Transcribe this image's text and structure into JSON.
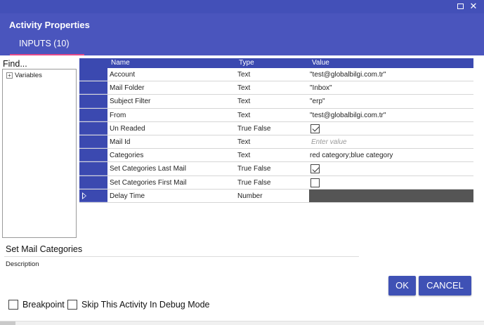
{
  "dialog": {
    "title": "Activity Properties",
    "tab_label": "INPUTS (10)"
  },
  "left_panel": {
    "find_label": "Find...",
    "tree_items": [
      {
        "toggle": "+",
        "label": "Variables"
      }
    ]
  },
  "grid": {
    "columns": {
      "name": "Name",
      "type": "Type",
      "value": "Value"
    },
    "rows": [
      {
        "name": "Account",
        "type": "Text",
        "value": "\"test@globalbilgi.com.tr\""
      },
      {
        "name": "Mail Folder",
        "type": "Text",
        "value": "\"Inbox\""
      },
      {
        "name": "Subject Filter",
        "type": "Text",
        "value": "\"erp\""
      },
      {
        "name": "From",
        "type": "Text",
        "value": "\"test@globalbilgi.com.tr\""
      },
      {
        "name": "Un Readed",
        "type": "True False",
        "checked": true
      },
      {
        "name": "Mail Id",
        "type": "Text",
        "placeholder": "Enter value"
      },
      {
        "name": "Categories",
        "type": "Text",
        "value": "red category;blue category"
      },
      {
        "name": "Set Categories Last Mail",
        "type": "True False",
        "checked": true
      },
      {
        "name": "Set Categories First Mail",
        "type": "True False",
        "checked": false
      },
      {
        "name": "Delay Time",
        "type": "Number",
        "selected": true
      }
    ]
  },
  "details": {
    "activity_name": "Set Mail Categories",
    "description_label": "Description"
  },
  "buttons": {
    "ok": "OK",
    "cancel": "CANCEL"
  },
  "options": {
    "breakpoint": "Breakpoint",
    "skip_debug": "Skip This Activity In Debug Mode"
  },
  "colors": {
    "header": "#4a55bd",
    "accent": "#e64b8a",
    "grid_header": "#3b49b0",
    "button": "#3f51b5"
  }
}
